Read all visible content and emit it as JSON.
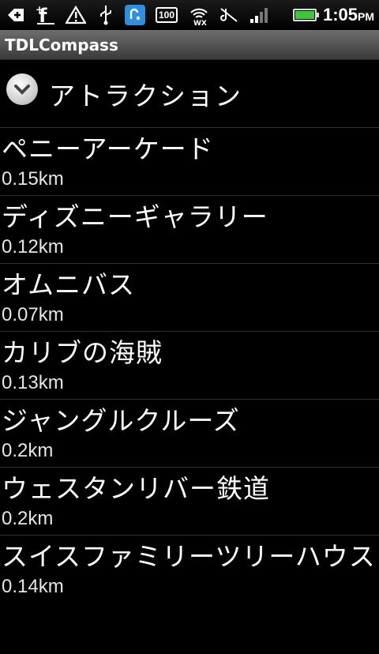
{
  "status_bar": {
    "icons": [
      "back-icon",
      "facebook-icon",
      "warning-icon",
      "usb-icon",
      "app-icon",
      "battery-100-icon",
      "wifi-icon",
      "mute-icon",
      "signal-icon"
    ],
    "battery_label": "100",
    "battery_level": 1.0,
    "time": "1:05",
    "ampm": "PM"
  },
  "app": {
    "title": "TDLCompass"
  },
  "group": {
    "title": "アトラクション"
  },
  "items": [
    {
      "name": "ペニーアーケード",
      "distance": "0.15km"
    },
    {
      "name": "ディズニーギャラリー",
      "distance": "0.12km"
    },
    {
      "name": "オムニバス",
      "distance": "0.07km"
    },
    {
      "name": "カリブの海賊",
      "distance": "0.13km"
    },
    {
      "name": "ジャングルクルーズ",
      "distance": "0.2km"
    },
    {
      "name": "ウェスタンリバー鉄道",
      "distance": "0.2km"
    },
    {
      "name": "スイスファミリーツリーハウス",
      "distance": "0.14km"
    }
  ]
}
